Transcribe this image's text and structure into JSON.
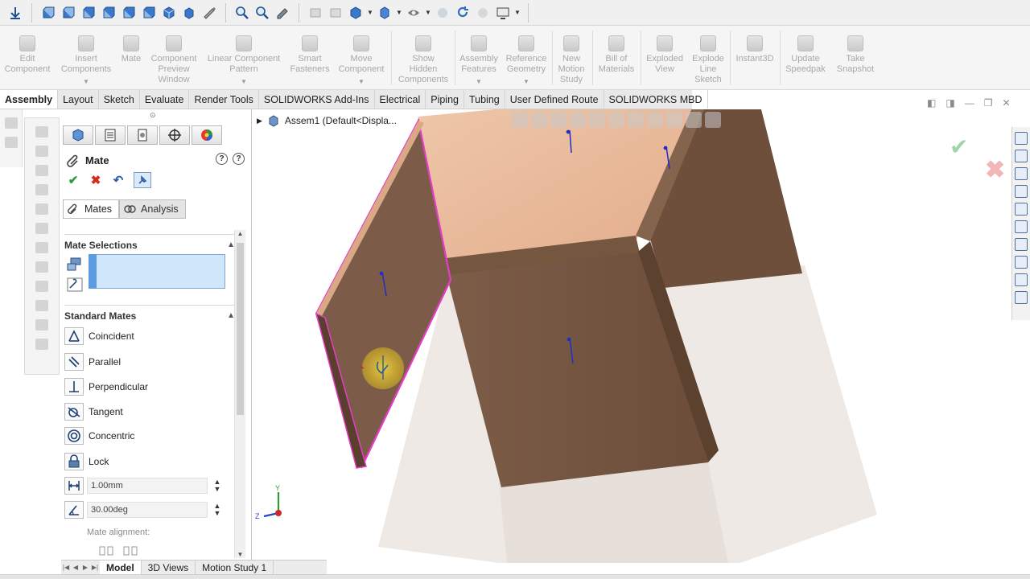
{
  "ribbon": {
    "edit_component": "Edit\nComponent",
    "insert_components": "Insert\nComponents",
    "mate": "Mate",
    "component_preview": "Component\nPreview\nWindow",
    "linear_pattern": "Linear Component\nPattern",
    "smart_fasteners": "Smart\nFasteners",
    "move_component": "Move\nComponent",
    "show_hidden": "Show\nHidden\nComponents",
    "assembly_features": "Assembly\nFeatures",
    "reference_geometry": "Reference\nGeometry",
    "new_motion_study": "New\nMotion\nStudy",
    "bill_of_materials": "Bill of\nMaterials",
    "exploded_view": "Exploded\nView",
    "explode_line_sketch": "Explode\nLine\nSketch",
    "instant3d": "Instant3D",
    "update_speedpak": "Update\nSpeedpak",
    "take_snapshot": "Take\nSnapshot"
  },
  "tabs": [
    "Assembly",
    "Layout",
    "Sketch",
    "Evaluate",
    "Render Tools",
    "SOLIDWORKS Add-Ins",
    "Electrical",
    "Piping",
    "Tubing",
    "User Defined Route",
    "SOLIDWORKS MBD"
  ],
  "tree": {
    "root": "Assem1  (Default<Displa..."
  },
  "pm": {
    "title": "Mate",
    "help_q": "?",
    "subtabs": {
      "mates": "Mates",
      "analysis": "Analysis"
    },
    "mate_selections": "Mate Selections",
    "standard_mates": "Standard Mates",
    "standard": [
      "Coincident",
      "Parallel",
      "Perpendicular",
      "Tangent",
      "Concentric",
      "Lock"
    ],
    "distance": "1.00mm",
    "angle": "30.00deg",
    "mate_alignment": "Mate alignment:"
  },
  "bottom_tabs": [
    "Model",
    "3D Views",
    "Motion Study 1"
  ],
  "triad": {
    "y": "Y",
    "z": "Z"
  },
  "colors": {
    "wood": "#7a5a45",
    "wood_light": "#e9b89a",
    "selection": "#e040c8",
    "accent": "#4a7fc1"
  }
}
